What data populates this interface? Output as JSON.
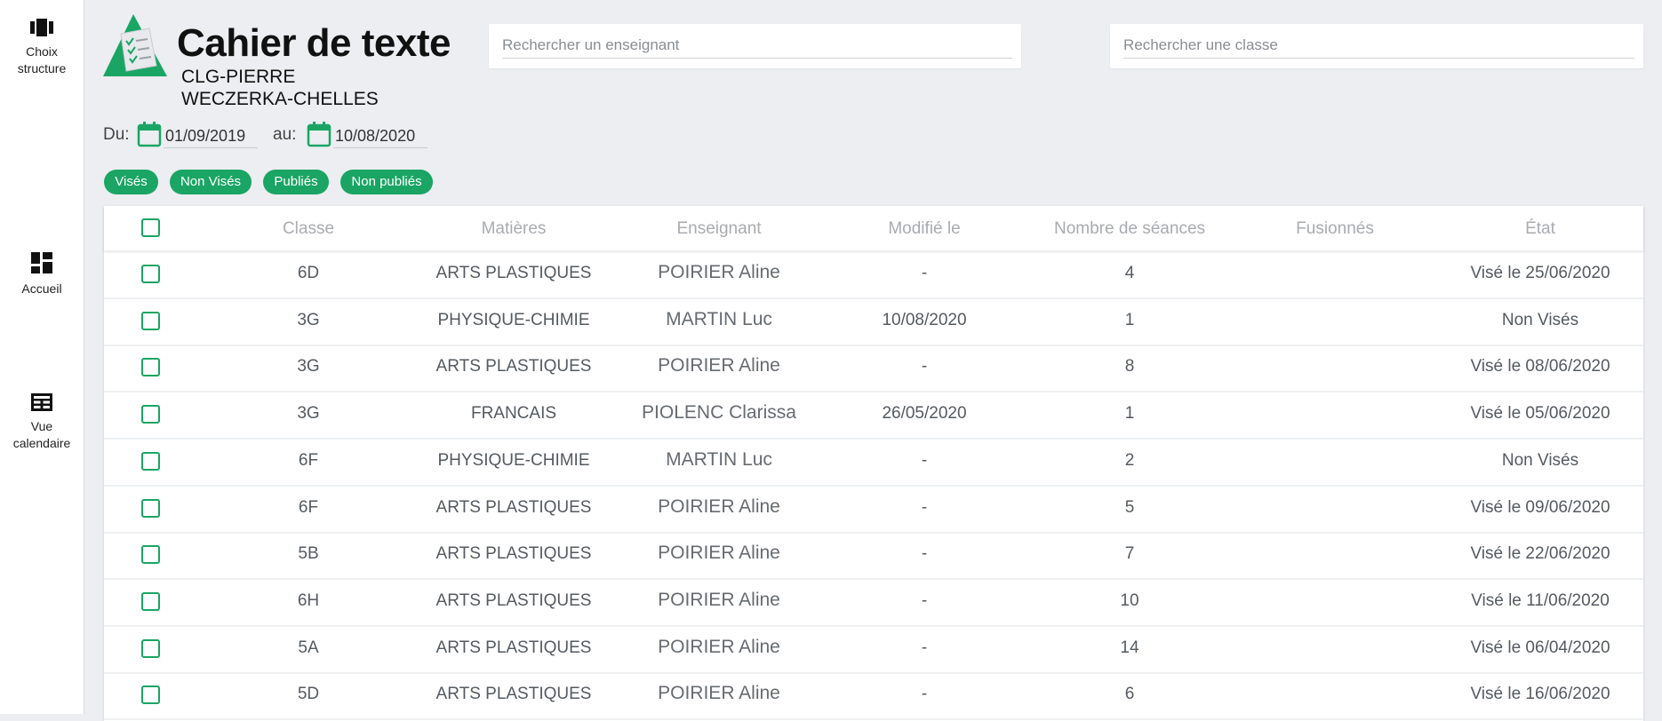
{
  "sidebar": {
    "items": [
      {
        "label": "Choix structure"
      },
      {
        "label": "Accueil"
      },
      {
        "label": "Vue calendaire"
      }
    ]
  },
  "header": {
    "title": "Cahier de texte",
    "school": "CLG-PIERRE WECZERKA-CHELLES",
    "search_teacher_placeholder": "Rechercher un enseignant",
    "search_class_placeholder": "Rechercher une classe"
  },
  "dates": {
    "from_label": "Du:",
    "from_value": "01/09/2019",
    "to_label": "au:",
    "to_value": "10/08/2020"
  },
  "filters": [
    "Visés",
    "Non Visés",
    "Publiés",
    "Non publiés"
  ],
  "colors": {
    "accent": "#1aa564",
    "background": "#eceef1"
  },
  "table": {
    "columns": [
      "Classe",
      "Matières",
      "Enseignant",
      "Modifié le",
      "Nombre de séances",
      "Fusionnés",
      "État"
    ],
    "rows": [
      {
        "classe": "6D",
        "matiere": "ARTS PLASTIQUES",
        "enseignant": "POIRIER Aline",
        "modifie": "-",
        "seances": "4",
        "fusionnes": "",
        "etat": "Visé le 25/06/2020"
      },
      {
        "classe": "3G",
        "matiere": "PHYSIQUE-CHIMIE",
        "enseignant": "MARTIN Luc",
        "modifie": "10/08/2020",
        "seances": "1",
        "fusionnes": "",
        "etat": "Non Visés"
      },
      {
        "classe": "3G",
        "matiere": "ARTS PLASTIQUES",
        "enseignant": "POIRIER Aline",
        "modifie": "-",
        "seances": "8",
        "fusionnes": "",
        "etat": "Visé le 08/06/2020"
      },
      {
        "classe": "3G",
        "matiere": "FRANCAIS",
        "enseignant": "PIOLENC Clarissa",
        "modifie": "26/05/2020",
        "seances": "1",
        "fusionnes": "",
        "etat": "Visé le 05/06/2020"
      },
      {
        "classe": "6F",
        "matiere": "PHYSIQUE-CHIMIE",
        "enseignant": "MARTIN Luc",
        "modifie": "-",
        "seances": "2",
        "fusionnes": "",
        "etat": "Non Visés"
      },
      {
        "classe": "6F",
        "matiere": "ARTS PLASTIQUES",
        "enseignant": "POIRIER Aline",
        "modifie": "-",
        "seances": "5",
        "fusionnes": "",
        "etat": "Visé le 09/06/2020"
      },
      {
        "classe": "5B",
        "matiere": "ARTS PLASTIQUES",
        "enseignant": "POIRIER Aline",
        "modifie": "-",
        "seances": "7",
        "fusionnes": "",
        "etat": "Visé le 22/06/2020"
      },
      {
        "classe": "6H",
        "matiere": "ARTS PLASTIQUES",
        "enseignant": "POIRIER Aline",
        "modifie": "-",
        "seances": "10",
        "fusionnes": "",
        "etat": "Visé le 11/06/2020"
      },
      {
        "classe": "5A",
        "matiere": "ARTS PLASTIQUES",
        "enseignant": "POIRIER Aline",
        "modifie": "-",
        "seances": "14",
        "fusionnes": "",
        "etat": "Visé le 06/04/2020"
      },
      {
        "classe": "5D",
        "matiere": "ARTS PLASTIQUES",
        "enseignant": "POIRIER Aline",
        "modifie": "-",
        "seances": "6",
        "fusionnes": "",
        "etat": "Visé le 16/06/2020"
      }
    ]
  }
}
